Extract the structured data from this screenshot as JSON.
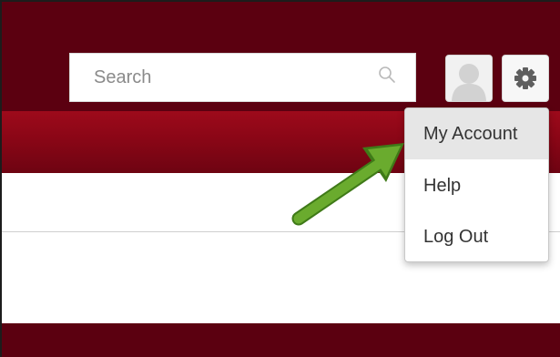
{
  "search": {
    "placeholder": "Search"
  },
  "account_menu": {
    "items": [
      {
        "label": "My Account",
        "highlighted": true
      },
      {
        "label": "Help",
        "highlighted": false
      },
      {
        "label": "Log Out",
        "highlighted": false
      }
    ]
  },
  "colors": {
    "header": "#5b0010",
    "subnav": "#8a0616",
    "menu_highlight": "#e6e6e6",
    "arrow": "#6aab2e"
  },
  "icons": {
    "search": "search-icon",
    "avatar": "user-avatar-icon",
    "settings": "gear-icon",
    "annotation": "green-arrow"
  }
}
